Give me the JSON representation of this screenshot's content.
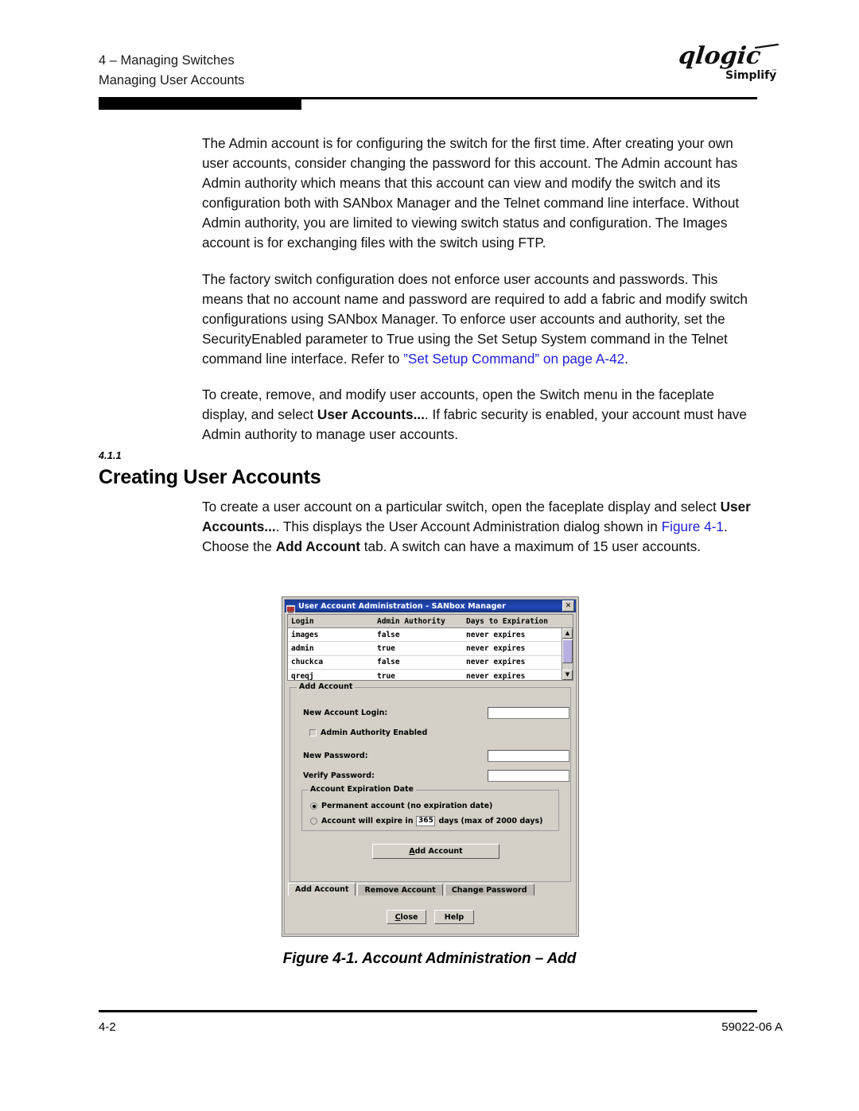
{
  "header": {
    "line1": "4 – Managing Switches",
    "line2": "Managing User Accounts",
    "logo_word": "qlogic",
    "logo_tagline": "Simplify",
    "logo_tm": "™"
  },
  "body": {
    "para1": "The Admin account is for configuring the switch for the first time. After creating your own user accounts, consider changing the password for this account. The Admin account has Admin authority which means that this account can view and modify the switch and its configuration both with SANbox Manager and the Telnet command line interface. Without Admin authority, you are limited to viewing switch status and configuration. The Images account is for exchanging files with the switch using FTP.",
    "para2_pre": "The factory switch configuration does not enforce user accounts and passwords. This means that no account name and password are required to add a fabric and modify switch configurations using SANbox Manager. To enforce user accounts and authority, set the SecurityEnabled parameter to True using the Set Setup System command in the Telnet command line interface. Refer to ",
    "para2_link": "”Set Setup Command” on page A-42",
    "para2_post": ".",
    "para3_a": "To create, remove, and modify user accounts, open the Switch menu in the faceplate display, and select ",
    "para3_bold": "User Accounts...",
    "para3_b": ". If fabric security is enabled, your account must have Admin authority to manage user accounts."
  },
  "section": {
    "number": "4.1.1",
    "title": "Creating User Accounts",
    "para_a": "To create a user account on a particular switch, open the faceplate display and select ",
    "para_bold1": "User Accounts...",
    "para_b": ". This displays the User Account Administration dialog shown in ",
    "para_link": "Figure 4-1",
    "para_c": ". Choose the ",
    "para_bold2": "Add Account",
    "para_d": " tab. A switch can have a maximum of 15 user accounts."
  },
  "dialog": {
    "title": "User Account Administration - SANbox Manager",
    "close_label": "✕",
    "table": {
      "columns": [
        "Login",
        "Admin Authority",
        "Days to Expiration"
      ],
      "rows": [
        [
          "images",
          "false",
          "never expires"
        ],
        [
          "admin",
          "true",
          "never expires"
        ],
        [
          "chuckca",
          "false",
          "never expires"
        ],
        [
          "qreqj",
          "true",
          "never expires"
        ]
      ]
    },
    "scroll_up": "▲",
    "scroll_down": "▼",
    "group_legend": "Add Account",
    "fields": {
      "login_label": "New Account Login:",
      "login_value": "",
      "checkbox_label": "Admin Authority Enabled",
      "checkbox_checked": false,
      "new_password_label": "New Password:",
      "new_password_value": "",
      "verify_password_label": "Verify Password:",
      "verify_password_value": ""
    },
    "expiration": {
      "legend": "Account Expiration Date",
      "option_permanent": "Permanent account (no expiration date)",
      "option_expire_pre": "Account will expire in",
      "days_value": "365",
      "option_expire_post": "days (max of 2000 days)",
      "selected": "permanent"
    },
    "add_button": {
      "prefix": "",
      "accel": "A",
      "rest": "dd Account"
    },
    "tabs": [
      {
        "label": "Add Account",
        "active": true
      },
      {
        "label": "Remove Account",
        "active": false
      },
      {
        "label": "Change Password",
        "active": false
      }
    ],
    "close_button": {
      "accel": "C",
      "rest": "lose"
    },
    "help_button": {
      "label": "Help"
    }
  },
  "figure_caption": "Figure 4-1.  Account Administration – Add",
  "footer": {
    "page": "4-2",
    "docnum": "59022-06  A"
  }
}
